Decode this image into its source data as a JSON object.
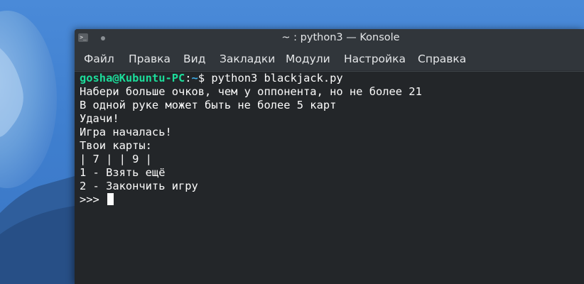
{
  "window": {
    "title": "~ : python3 — Konsole",
    "app_icon": "terminal-icon",
    "app_icon_glyph": ">_"
  },
  "menu": {
    "items": [
      "Файл",
      "Правка",
      "Вид",
      "Закладки",
      "Модули",
      "Настройка",
      "Справка"
    ]
  },
  "terminal": {
    "prompt_user": "gosha@Kubuntu-PC",
    "prompt_sep": ":",
    "prompt_path": "~",
    "prompt_symbol": "$",
    "command": " python3 blackjack.py",
    "output_lines": [
      "Набери больше очков, чем у оппонента, но не более 21",
      "В одной руке может быть не более 5 карт",
      "Удачи!",
      "Игра началась!",
      "Твои карты:",
      "| 7 | | 9 |",
      "1 - Взять ещё",
      "2 - Закончить игру"
    ],
    "input_prompt": ">>> "
  },
  "colors": {
    "desktop": "#3f80d0",
    "window_bg": "#232629",
    "titlebar": "#31363b",
    "prompt_user": "#1cdc9a",
    "prompt_path": "#3daee9",
    "text": "#fcfcfc"
  }
}
